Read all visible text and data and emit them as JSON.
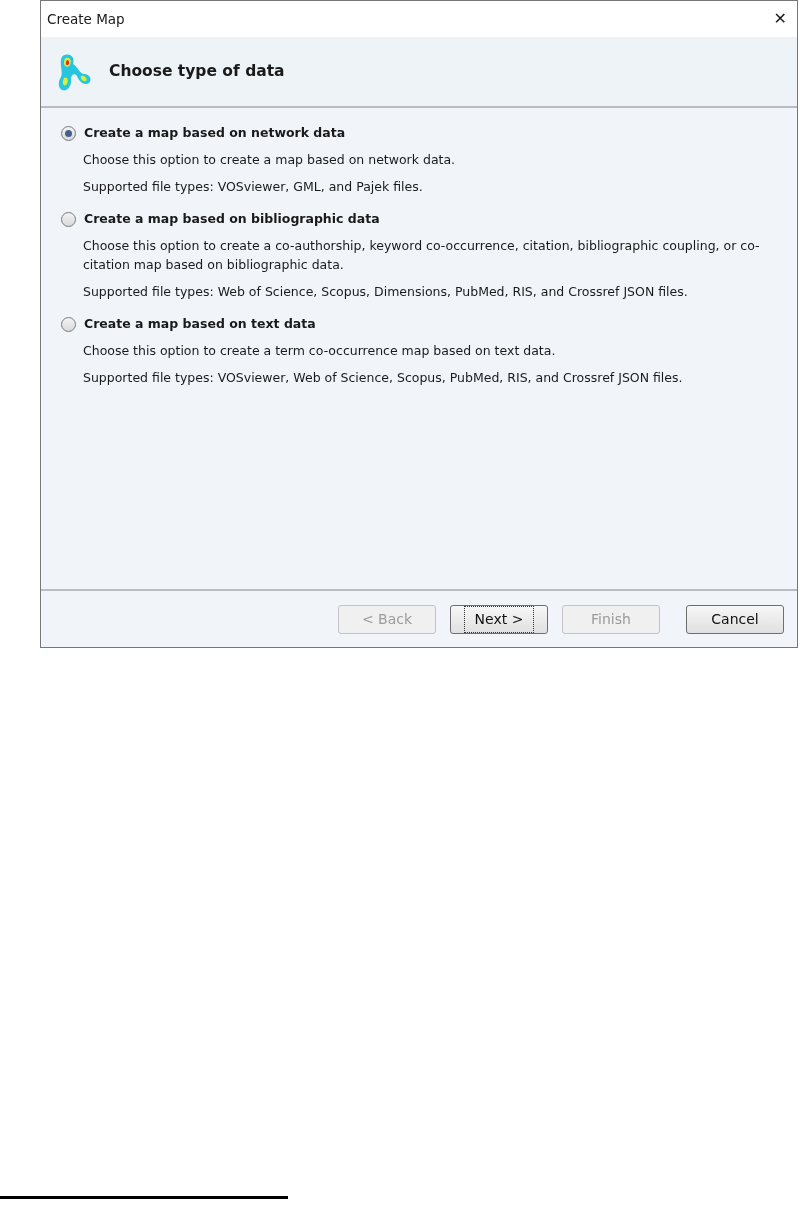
{
  "window": {
    "title": "Create Map",
    "close": "✕"
  },
  "header": {
    "title": "Choose type of data"
  },
  "options": [
    {
      "label": "Create a map based on network data",
      "selected": true,
      "description": "Choose this option to create a map based on network data.",
      "file_types": "Supported file types: VOSviewer, GML, and Pajek files."
    },
    {
      "label": "Create a map based on bibliographic data",
      "selected": false,
      "description": "Choose this option to create a co-authorship, keyword co-occurrence, citation, bibliographic coupling, or co-citation map based on bibliographic data.",
      "file_types": "Supported file types: Web of Science, Scopus, Dimensions, PubMed, RIS, and Crossref JSON files."
    },
    {
      "label": "Create a map based on text data",
      "selected": false,
      "description": "Choose this option to create a term co-occurrence map based on text data.",
      "file_types": "Supported file types: VOSviewer, Web of Science, Scopus, PubMed, RIS, and Crossref JSON files."
    }
  ],
  "buttons": [
    {
      "label": "< Back",
      "disabled": true,
      "focused": false
    },
    {
      "label": "Next >",
      "disabled": false,
      "focused": true
    },
    {
      "label": "Finish",
      "disabled": true,
      "focused": false
    },
    {
      "label": "Cancel",
      "disabled": false,
      "focused": false
    }
  ]
}
